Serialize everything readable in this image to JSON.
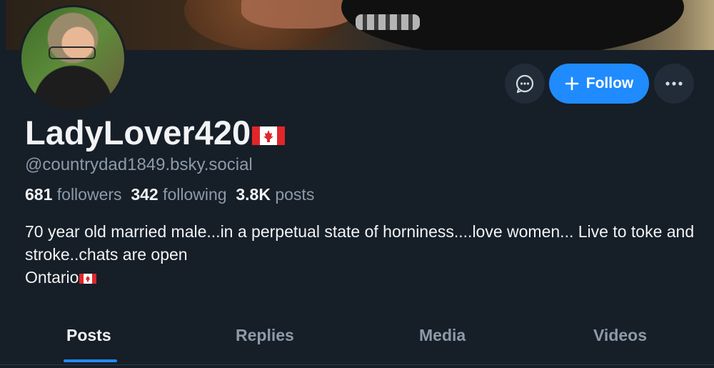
{
  "profile": {
    "display_name": "LadyLover420",
    "handle": "@countrydad1849.bsky.social",
    "bio_line1": "70 year old married male...in a perpetual state of horniness....love women... Live to toke and stroke..chats are open",
    "bio_line2": "Ontario"
  },
  "stats": {
    "followers_count": "681",
    "followers_label": "followers",
    "following_count": "342",
    "following_label": "following",
    "posts_count": "3.8K",
    "posts_label": "posts"
  },
  "actions": {
    "follow_label": "Follow",
    "message_icon": "chat-bubble-icon",
    "more_icon": "ellipsis-icon"
  },
  "tabs": [
    {
      "label": "Posts",
      "active": true
    },
    {
      "label": "Replies",
      "active": false
    },
    {
      "label": "Media",
      "active": false
    },
    {
      "label": "Videos",
      "active": false
    }
  ],
  "colors": {
    "background": "#161e27",
    "accent": "#208bfe",
    "muted_text": "#8c9aa9"
  }
}
